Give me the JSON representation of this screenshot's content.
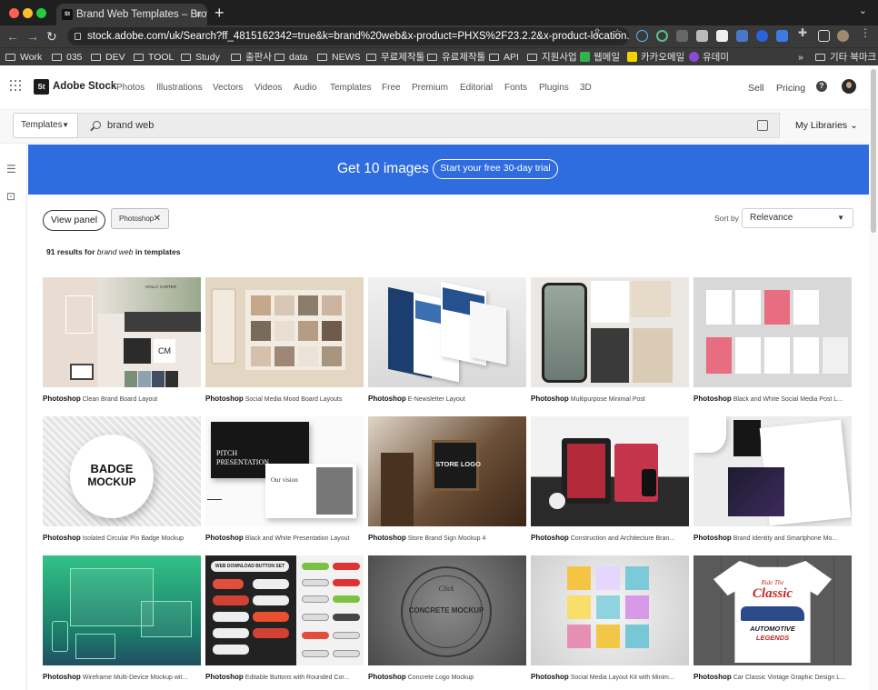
{
  "browser": {
    "tab_title": "Brand Web Templates – Brows",
    "tab_icon_text": "St",
    "new_tab_glyph": "+",
    "url": "stock.adobe.com/uk/Search?ff_4815162342=true&k=brand%20web&x-product=PHXS%2F23.2.2&x-product-location...",
    "bookmarks": [
      "Work",
      "035",
      "DEV",
      "TOOL",
      "Study",
      "출판사",
      "data",
      "NEWS",
      "무료제작툴",
      "유료제작툴",
      "API",
      "지원사업",
      "웹메일",
      "카카오메일",
      "유데미"
    ],
    "bookmarks_more": "»",
    "other_bookmarks": "기타 북마크"
  },
  "app": {
    "logo_text": "St",
    "brand": "Adobe Stock",
    "nav": [
      "Photos",
      "Illustrations",
      "Vectors",
      "Videos",
      "Audio",
      "Templates",
      "Free",
      "Premium",
      "Editorial",
      "Fonts",
      "Plugins",
      "3D"
    ],
    "sell": "Sell",
    "pricing": "Pricing",
    "help": "?"
  },
  "search": {
    "category": "Templates",
    "query": "brand web",
    "my_libraries": "My Libraries"
  },
  "banner": {
    "text": "Get 10 images",
    "button": "Start your free 30-day trial",
    "color": "#2f6cdf"
  },
  "filters": {
    "view_panel": "View panel",
    "chip": "Photoshop",
    "sort_by_label": "Sort by",
    "sort_value": "Relevance"
  },
  "results": {
    "count": "91 results for",
    "query": "brand web",
    "suffix": "in templates"
  },
  "cards": [
    {
      "app": "Photoshop",
      "title": "Clean Brand Board Layout"
    },
    {
      "app": "Photoshop",
      "title": "Social Media Mood Board Layouts"
    },
    {
      "app": "Photoshop",
      "title": "E-Newsletter Layout"
    },
    {
      "app": "Photoshop",
      "title": "Multipurpose Minimal Post"
    },
    {
      "app": "Photoshop",
      "title": "Black and White Social Media Post L..."
    },
    {
      "app": "Photoshop",
      "title": "Isolated Circular Pin Badge Mockup"
    },
    {
      "app": "Photoshop",
      "title": "Black and White Presentation Layout"
    },
    {
      "app": "Photoshop",
      "title": "Store Brand Sign Mockup 4"
    },
    {
      "app": "Photoshop",
      "title": "Construction and Architecture Bran..."
    },
    {
      "app": "Photoshop",
      "title": "Brand Identity and Smartphone Mo..."
    },
    {
      "app": "Photoshop",
      "title": "Wireframe Multi-Device Mockup wit..."
    },
    {
      "app": "Photoshop",
      "title": "Editable Buttons with Rounded Cor..."
    },
    {
      "app": "Photoshop",
      "title": "Concrete Logo Mockup"
    },
    {
      "app": "Photoshop",
      "title": "Social Media Layout Kit with Minim..."
    },
    {
      "app": "Photoshop",
      "title": "Car Classic Vintage Graphic Design L..."
    }
  ],
  "thumb_text": {
    "c1": "HOLLY CARTER",
    "c5a": "BADGE",
    "c5b": "MOCKUP",
    "c6a": "PITCH",
    "c6b": "PRESENTATION",
    "c6c": "Our vision",
    "c7": "STORE LOGO",
    "c11": "WEB DOWNLOAD BUTTON SET",
    "c12a": "CONCRETE MOCKUP",
    "c12b": "Click",
    "c14a": "Ride The",
    "c14b": "Classic",
    "c14c": "AUTOMOTIVE",
    "c14d": "LEGENDS"
  }
}
